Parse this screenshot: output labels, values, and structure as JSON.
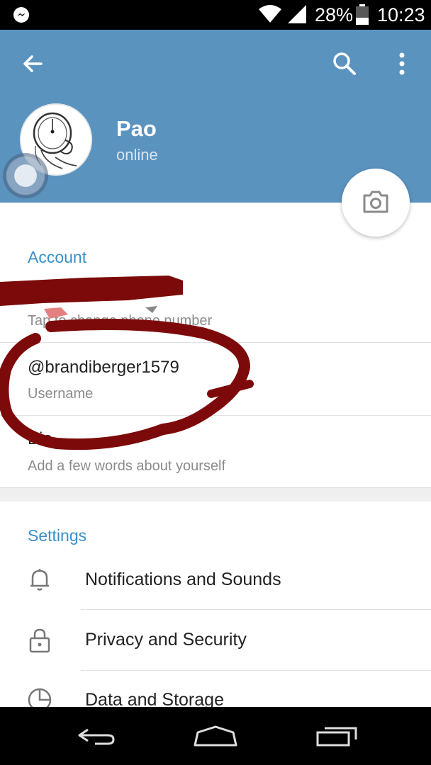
{
  "status_bar": {
    "battery_percent": "28%",
    "time": "10:23",
    "icons": [
      "messenger-icon",
      "wifi-icon",
      "signal-icon",
      "battery-icon"
    ]
  },
  "header": {
    "name": "Pao",
    "status": "online",
    "background_color": "#5b93bf"
  },
  "account": {
    "section_title": "Account",
    "phone_hint": "Tap to change phone number",
    "username_value": "@brandiberger1579",
    "username_hint": "Username",
    "bio_value": "Bio",
    "bio_hint": "Add a few words about yourself"
  },
  "settings": {
    "section_title": "Settings",
    "items": [
      {
        "label": "Notifications and Sounds",
        "icon": "bell-icon"
      },
      {
        "label": "Privacy and Security",
        "icon": "lock-icon"
      },
      {
        "label": "Data and Storage",
        "icon": "pie-chart-icon"
      }
    ]
  },
  "accent_color": "#3a8fc9",
  "annotation_color": "#7d0a0a"
}
